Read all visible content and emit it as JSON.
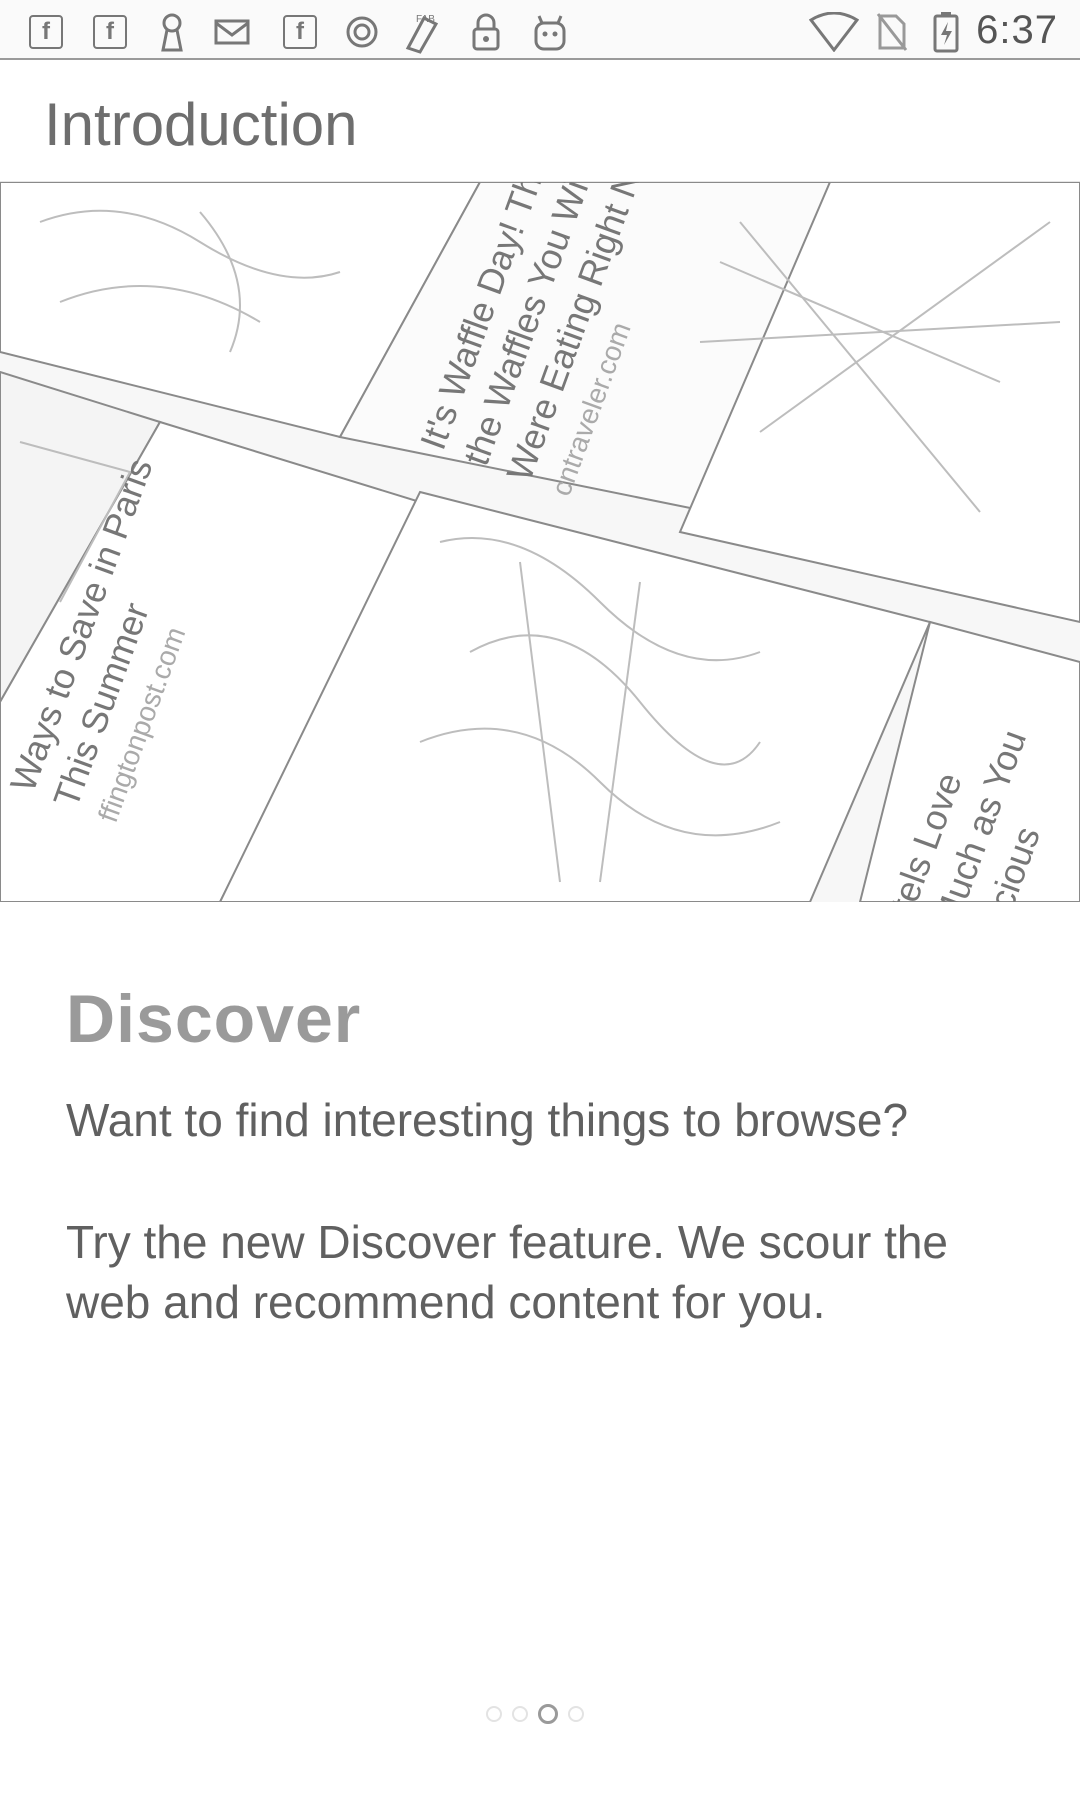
{
  "status_bar": {
    "icons": [
      "facebook-icon",
      "facebook-icon",
      "keyhole-icon",
      "mail-icon",
      "facebook-icon",
      "ring-icon",
      "fabric-icon",
      "lock-icon",
      "android-icon"
    ],
    "right_icons": [
      "wifi-icon",
      "no-sim-icon",
      "battery-charging-icon"
    ],
    "time": "6:37"
  },
  "toolbar": {
    "title": "Introduction"
  },
  "illustration": {
    "cards": [
      {
        "headline_lines": [
          "It's Waffle Day! Th",
          "the Waffles You Wi",
          "Were Eating Right N"
        ],
        "source": "cntraveler.com"
      },
      {
        "headline_lines": [
          "Ways to Save in Paris",
          "This Summer"
        ],
        "source": "ffingtonpost.com"
      },
      {
        "headline_lines": [
          "tels Love",
          "Much as You",
          "elicious"
        ],
        "source": ""
      }
    ]
  },
  "content": {
    "heading": "Discover",
    "paragraph1": "Want to find interesting things to browse?",
    "paragraph2": "Try the new Discover feature. We scour the web and recommend content for you."
  },
  "pager": {
    "total": 4,
    "active_index": 2
  },
  "colors": {
    "text": "#606060",
    "heading": "#9a9a9a",
    "title": "#6e6e6e"
  }
}
